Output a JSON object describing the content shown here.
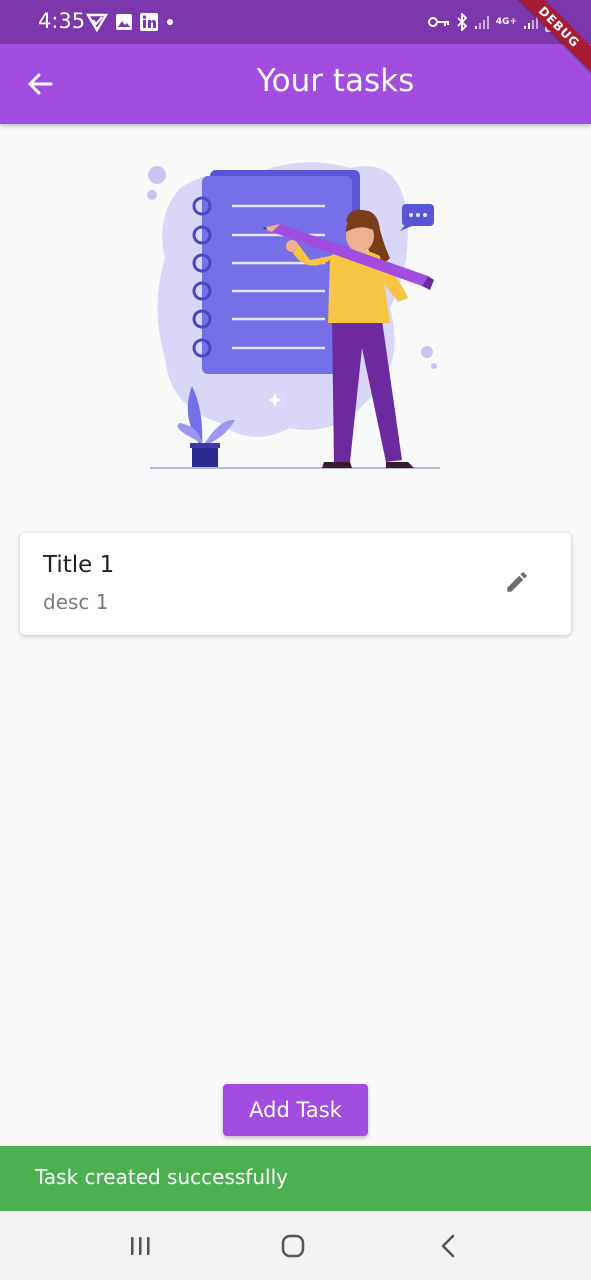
{
  "status_bar": {
    "time": "4:35",
    "network_label": "4G+",
    "left_icons": [
      "vpn-shield-icon",
      "gallery-icon",
      "linkedin-icon",
      "dot-icon"
    ],
    "right_icons": [
      "key-icon",
      "bluetooth-icon",
      "signal-icon",
      "signal-icon",
      "battery-icon"
    ]
  },
  "debug_banner": "DEBUG",
  "app_bar": {
    "title": "Your tasks",
    "back_icon": "arrow-back-icon"
  },
  "tasks": [
    {
      "title": "Title 1",
      "description": "desc 1",
      "action_icon": "edit-pencil-icon"
    }
  ],
  "add_task_label": "Add Task",
  "snackbar": {
    "message": "Task created successfully"
  },
  "navigation": {
    "buttons": [
      "recents-icon",
      "home-icon",
      "back-icon"
    ]
  },
  "colors": {
    "status_bar": "#7d37ad",
    "primary": "#a24ce0",
    "snackbar": "#4caf50",
    "debug": "#a51c34"
  }
}
